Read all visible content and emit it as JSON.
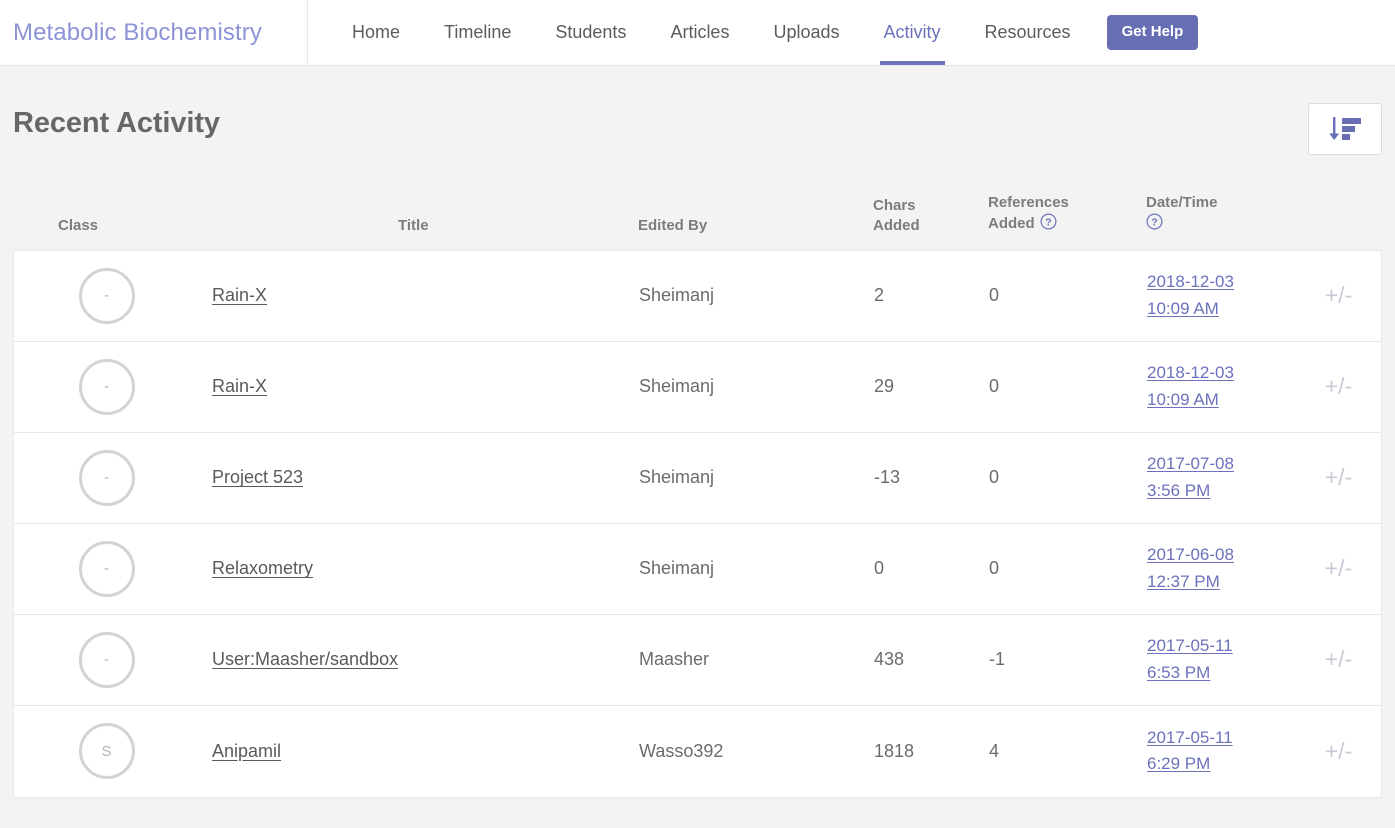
{
  "navbar": {
    "brand": "Metabolic Biochemistry",
    "links": [
      {
        "label": "Home",
        "active": false
      },
      {
        "label": "Timeline",
        "active": false
      },
      {
        "label": "Students",
        "active": false
      },
      {
        "label": "Articles",
        "active": false
      },
      {
        "label": "Uploads",
        "active": false
      },
      {
        "label": "Activity",
        "active": true
      },
      {
        "label": "Resources",
        "active": false
      }
    ],
    "get_help_label": "Get Help",
    "accent_color": "#676eb4"
  },
  "page": {
    "title": "Recent Activity",
    "sort_icon": "sort-descending-icon",
    "background": "#f3f3f3"
  },
  "table": {
    "headers": {
      "class": "Class",
      "title": "Title",
      "edited_by": "Edited By",
      "chars_added_line1": "Chars",
      "chars_added_line2": "Added",
      "references_added_line1": "References",
      "references_added_line2": "Added",
      "date_time": "Date/Time"
    },
    "rows": [
      {
        "class": "-",
        "title": "Rain-X ",
        "edited_by": "Sheimanj",
        "chars_added": "2",
        "references_added": "0",
        "date": "2018-12-03",
        "time": "10:09 AM",
        "diff": "+/-"
      },
      {
        "class": "-",
        "title": "Rain-X ",
        "edited_by": "Sheimanj",
        "chars_added": "29",
        "references_added": "0",
        "date": "2018-12-03",
        "time": "10:09 AM",
        "diff": "+/-"
      },
      {
        "class": "-",
        "title": "Project 523 ",
        "edited_by": "Sheimanj",
        "chars_added": "-13",
        "references_added": "0",
        "date": "2017-07-08",
        "time": "3:56 PM",
        "diff": "+/-"
      },
      {
        "class": "-",
        "title": "Relaxometry ",
        "edited_by": "Sheimanj",
        "chars_added": "0",
        "references_added": "0",
        "date": "2017-06-08",
        "time": "12:37 PM",
        "diff": "+/-"
      },
      {
        "class": "-",
        "title": "User:Maasher/sandbox ",
        "edited_by": "Maasher",
        "chars_added": "438",
        "references_added": "-1",
        "date": "2017-05-11",
        "time": "6:53 PM",
        "diff": "+/-"
      },
      {
        "class": "S",
        "title": "Anipamil ",
        "edited_by": "Wasso392",
        "chars_added": "1818",
        "references_added": "4",
        "date": "2017-05-11",
        "time": "6:29 PM",
        "diff": "+/-"
      }
    ]
  }
}
